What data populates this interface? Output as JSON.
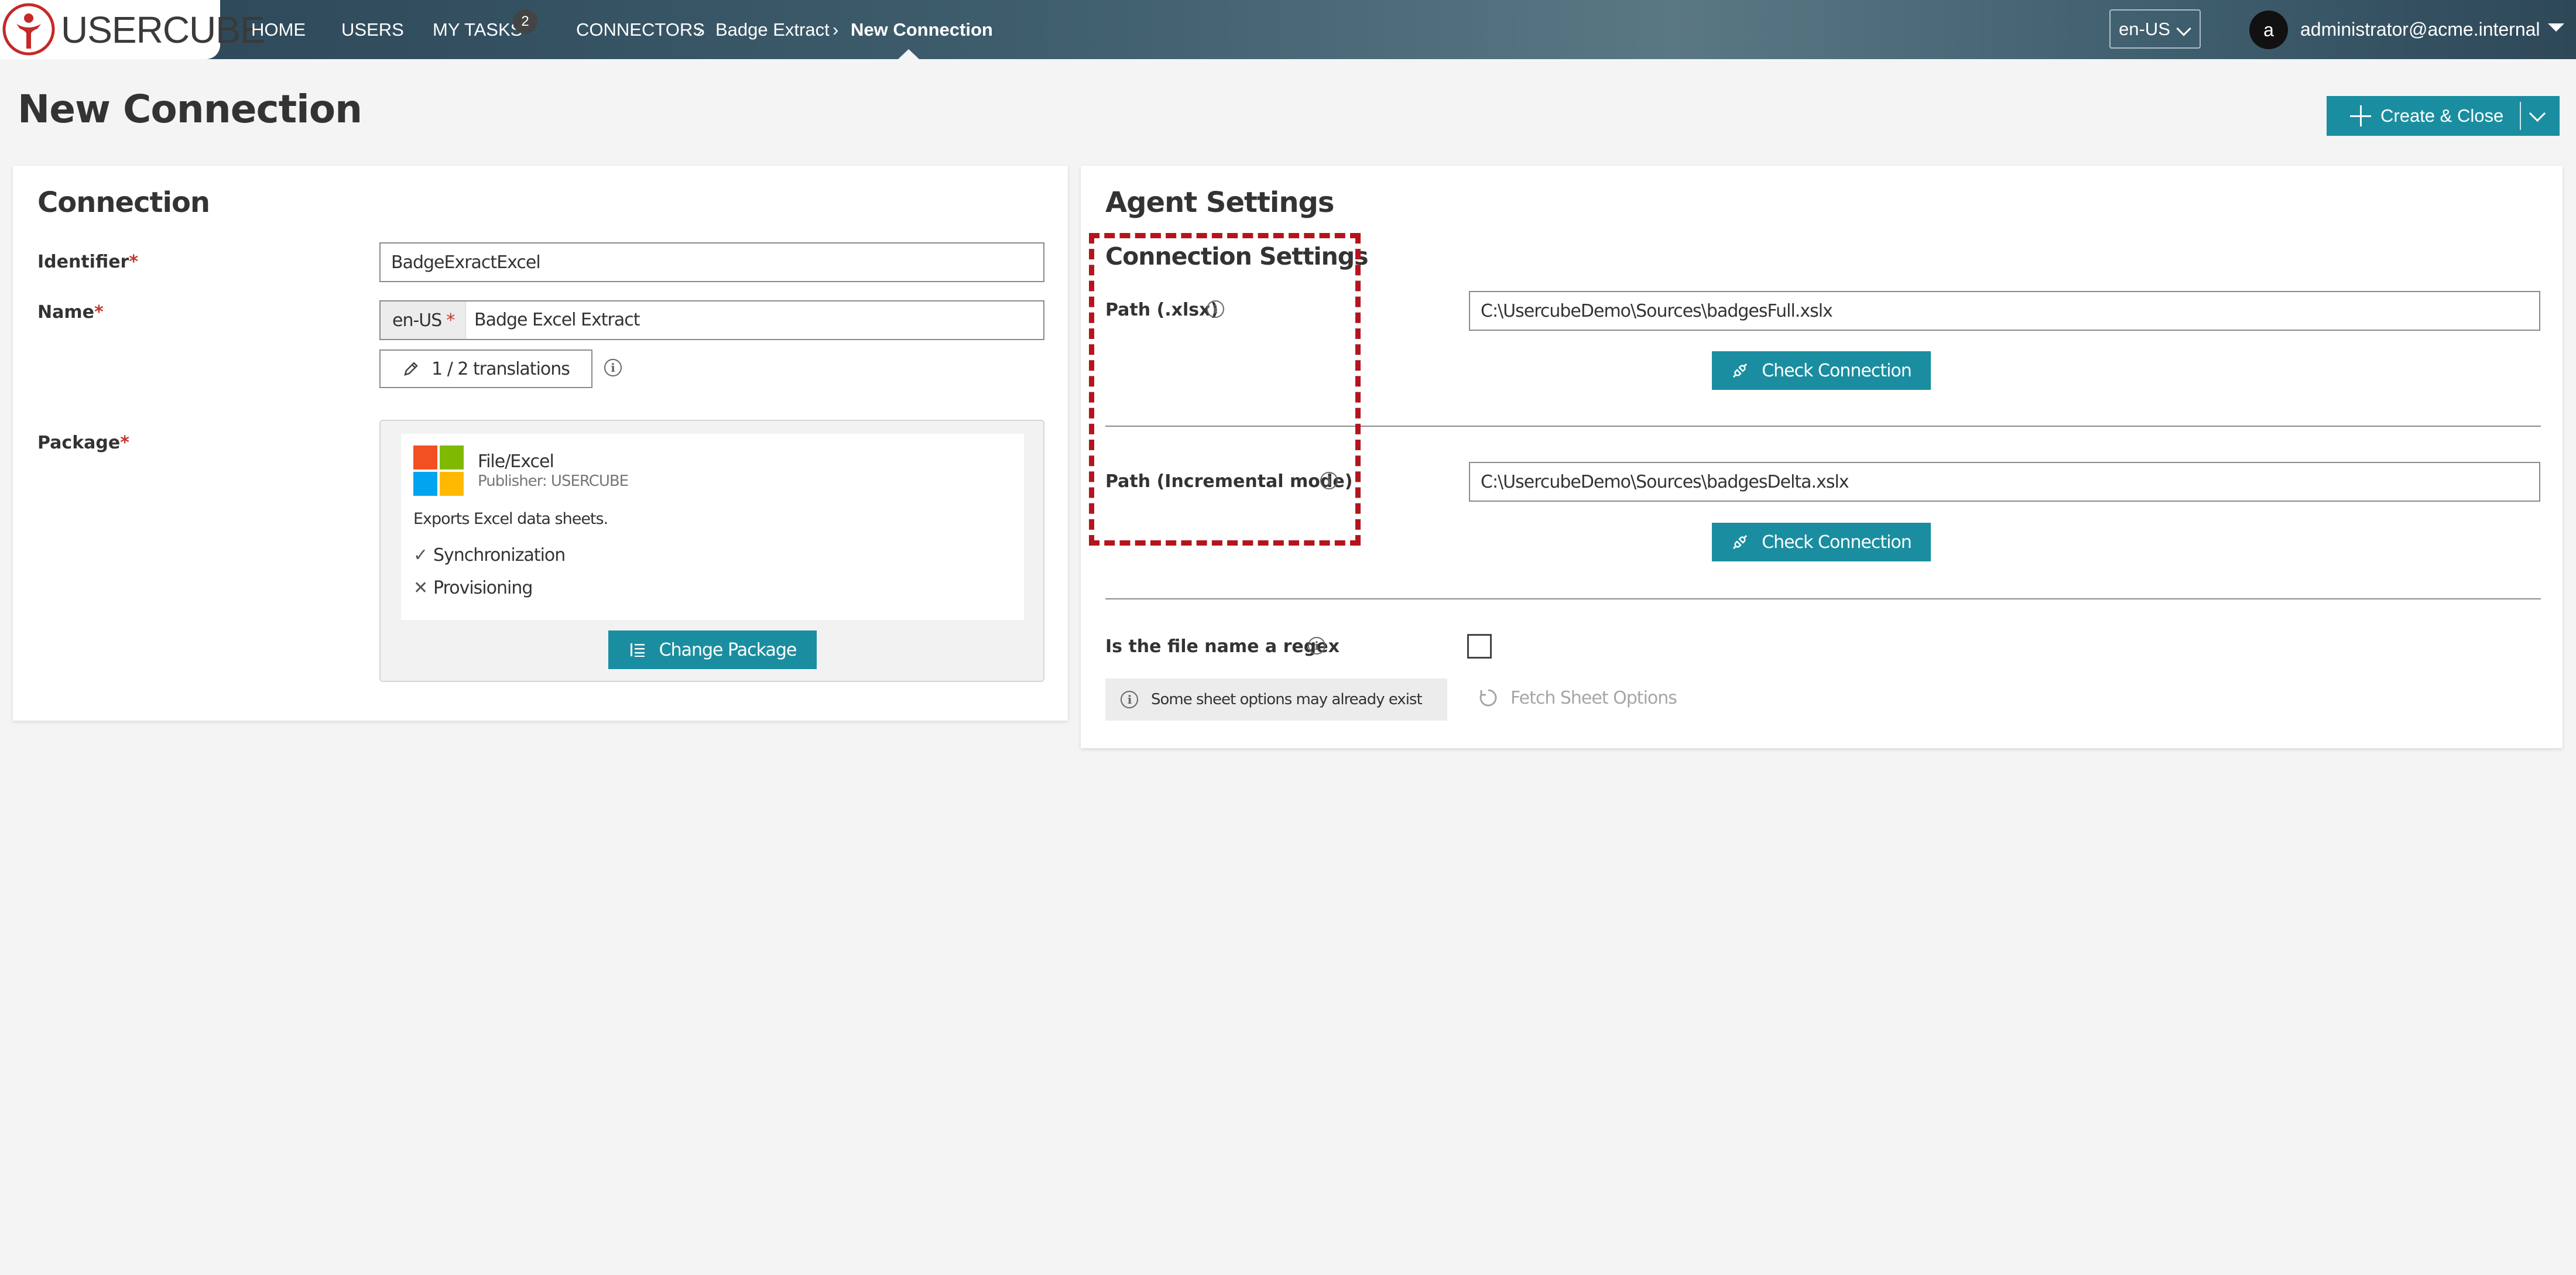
{
  "app": {
    "logo_text": "USERCUBE",
    "brand_color": "#1a8ea0",
    "nav": {
      "home": "HOME",
      "users": "USERS",
      "my_tasks": "MY TASKS",
      "tasks_count": "2",
      "connectors": "CONNECTORS",
      "breadcrumb_1": "Badge Extract",
      "breadcrumb_2": "New Connection"
    },
    "language": "en-US",
    "user": {
      "initial": "a",
      "email": "administrator@acme.internal"
    }
  },
  "page": {
    "title": "New Connection",
    "create_button": "Create & Close"
  },
  "connection": {
    "heading": "Connection",
    "identifier_label": "Identifier",
    "identifier_value": "BadgeExractExcel",
    "name_label": "Name",
    "name_lang": "en-US",
    "name_value": "Badge Excel Extract",
    "translations_label": "1 / 2 translations",
    "package_label": "Package",
    "required_mark": "*",
    "package": {
      "name": "File/Excel",
      "publisher": "Publisher: USERCUBE",
      "description": "Exports Excel data sheets.",
      "capabilities": [
        {
          "label": "Synchronization",
          "supported": true,
          "mark": "✓"
        },
        {
          "label": "Provisioning",
          "supported": false,
          "mark": "✕"
        }
      ],
      "change_button": "Change Package"
    }
  },
  "agent": {
    "heading": "Agent Settings",
    "section_heading": "Connection Settings",
    "path_label": "Path (.xlsx)",
    "path_value": "C:\\UsercubeDemo\\Sources\\badgesFull.xslx",
    "check_button_1": "Check Connection",
    "incremental_label": "Path (Incremental mode)",
    "incremental_value": "C:\\UsercubeDemo\\Sources\\badgesDelta.xslx",
    "check_button_2": "Check Connection",
    "regex_label": "Is the file name a regex",
    "regex_checked": false,
    "notice": "Some sheet options may already exist",
    "fetch_label": "Fetch Sheet Options"
  }
}
